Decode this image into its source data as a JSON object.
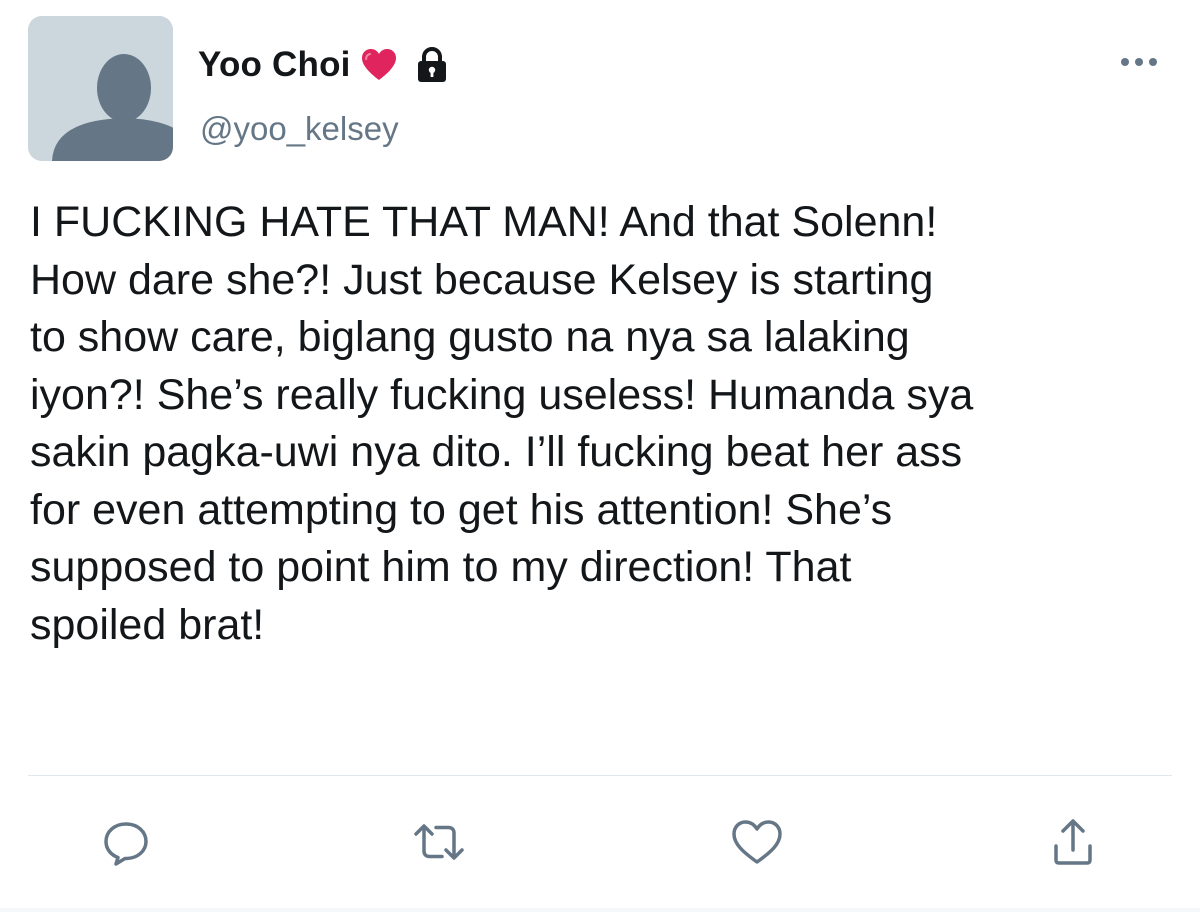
{
  "tweet": {
    "display_name": "Yoo Choi",
    "handle": "@yoo_kelsey",
    "text": "I FUCKING HATE THAT MAN! And that Solenn!\nHow dare she?! Just because Kelsey is starting\nto show care, biglang gusto na nya sa lalaking\niyon?! She’s really fucking useless! Humanda sya\nsakin pagka-uwi nya dito. I’ll fucking beat her ass\nfor even attempting to get his attention! She’s\nsupposed to point him to my direction! That\nspoiled brat!"
  },
  "icons": {
    "name_badges": [
      "heart-icon",
      "lock-icon"
    ],
    "header_menu": "more-dots-icon",
    "actions": [
      "reply-icon",
      "retweet-icon",
      "like-icon",
      "share-icon"
    ]
  },
  "colors": {
    "text": "#14171a",
    "secondary_text": "#657786",
    "icon": "#657786",
    "heart": "#e0245e",
    "avatar_bg": "#ccd6dd",
    "avatar_figure": "#657786",
    "divider": "#e1e8ed"
  }
}
